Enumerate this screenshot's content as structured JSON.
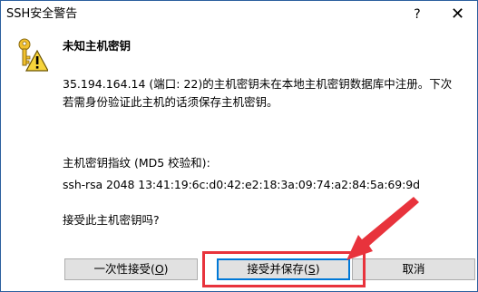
{
  "window": {
    "title": "SSH安全警告",
    "help_label": "?",
    "close_label": "✕"
  },
  "dialog": {
    "heading": "未知主机密钥",
    "message": "35.194.164.14 (端口: 22)的主机密钥未在本地主机密钥数据库中注册。下次若需身份验证此主机的话须保存主机密钥。",
    "fingerprint_label": "主机密钥指纹 (MD5 校验和):",
    "fingerprint_value": "ssh-rsa 2048 13:41:19:6c:d0:42:e2:18:3a:09:74:a2:84:5a:69:9d",
    "question": "接受此主机密钥吗?"
  },
  "buttons": {
    "accept_once": {
      "label": "一次性接受(",
      "mnemonic": "O",
      "suffix": ")"
    },
    "accept_save": {
      "label": "接受并保存(",
      "mnemonic": "S",
      "suffix": ")"
    },
    "cancel": {
      "label": "取消"
    }
  },
  "icons": {
    "warning": "key-warning-icon"
  },
  "colors": {
    "annotation": "#e8333c",
    "focus_border": "#0078d7",
    "button_bg": "#e1e1e1"
  }
}
